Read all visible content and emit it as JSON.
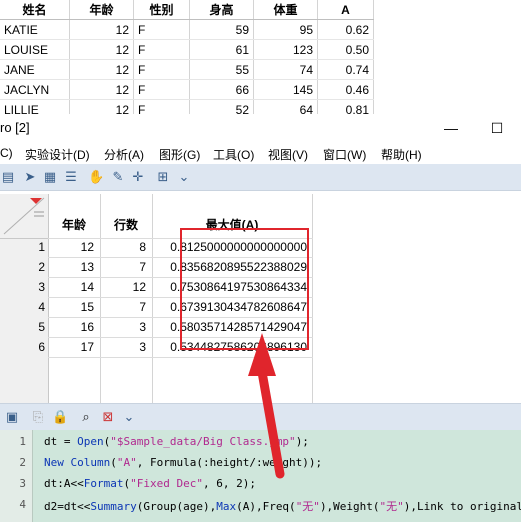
{
  "top_table": {
    "headers": [
      "姓名",
      "年龄",
      "性别",
      "身高",
      "体重",
      "A"
    ],
    "rows": [
      [
        "KATIE",
        "12",
        "F",
        "59",
        "95",
        "0.62"
      ],
      [
        "LOUISE",
        "12",
        "F",
        "61",
        "123",
        "0.50"
      ],
      [
        "JANE",
        "12",
        "F",
        "55",
        "74",
        "0.74"
      ],
      [
        "JACLYN",
        "12",
        "F",
        "66",
        "145",
        "0.46"
      ],
      [
        "LILLIE",
        "12",
        "F",
        "52",
        "64",
        "0.81"
      ]
    ]
  },
  "window": {
    "title": "ro [2]",
    "minimize": "—",
    "maximize": "☐",
    "menus": [
      "C)",
      "实验设计(D)",
      "分析(A)",
      "图形(G)",
      "工具(O)",
      "视图(V)",
      "窗口(W)",
      "帮助(H)"
    ]
  },
  "grid": {
    "columns": [
      "年龄",
      "行数",
      "最大值(A)"
    ],
    "rows": [
      {
        "n": "1",
        "age": "12",
        "count": "8",
        "max": "0.8125000000000000000"
      },
      {
        "n": "2",
        "age": "13",
        "count": "7",
        "max": "0.8356820895522388029"
      },
      {
        "n": "3",
        "age": "14",
        "count": "12",
        "max": "0.7530864197530864334"
      },
      {
        "n": "4",
        "age": "15",
        "count": "7",
        "max": "0.6739130434782608647"
      },
      {
        "n": "5",
        "age": "16",
        "count": "3",
        "max": "0.5803571428571429047"
      },
      {
        "n": "6",
        "age": "17",
        "count": "3",
        "max": "0.5344827586206896130"
      }
    ]
  },
  "script": {
    "line_numbers": [
      "1",
      "2",
      "3",
      "4"
    ],
    "line1": {
      "a": "dt = ",
      "b": "Open",
      "c": "(",
      "d": "\"$Sample_data/Big Class.jmp\"",
      "e": ");"
    },
    "line2": {
      "a": "New Column",
      "b": "(",
      "c": "\"A\"",
      "d": ", Formula(:height/:weight));"
    },
    "line3": {
      "a": "dt:A<<",
      "b": "Format",
      "c": "(",
      "d": "\"Fixed Dec\"",
      "e": ", 6, 2);"
    },
    "line4": {
      "a": "d2=dt<<",
      "b": "Summary",
      "c": "(Group(age),",
      "d": "Max",
      "e": "(A),Freq(",
      "f": "\"无\"",
      "g": "),Weight(",
      "h": "\"无\"",
      "i": "),Link to original"
    }
  },
  "colors": {
    "highlight": "#e0252c",
    "toolbar": "#dde6f1",
    "editor_bg": "#cfe6db"
  }
}
